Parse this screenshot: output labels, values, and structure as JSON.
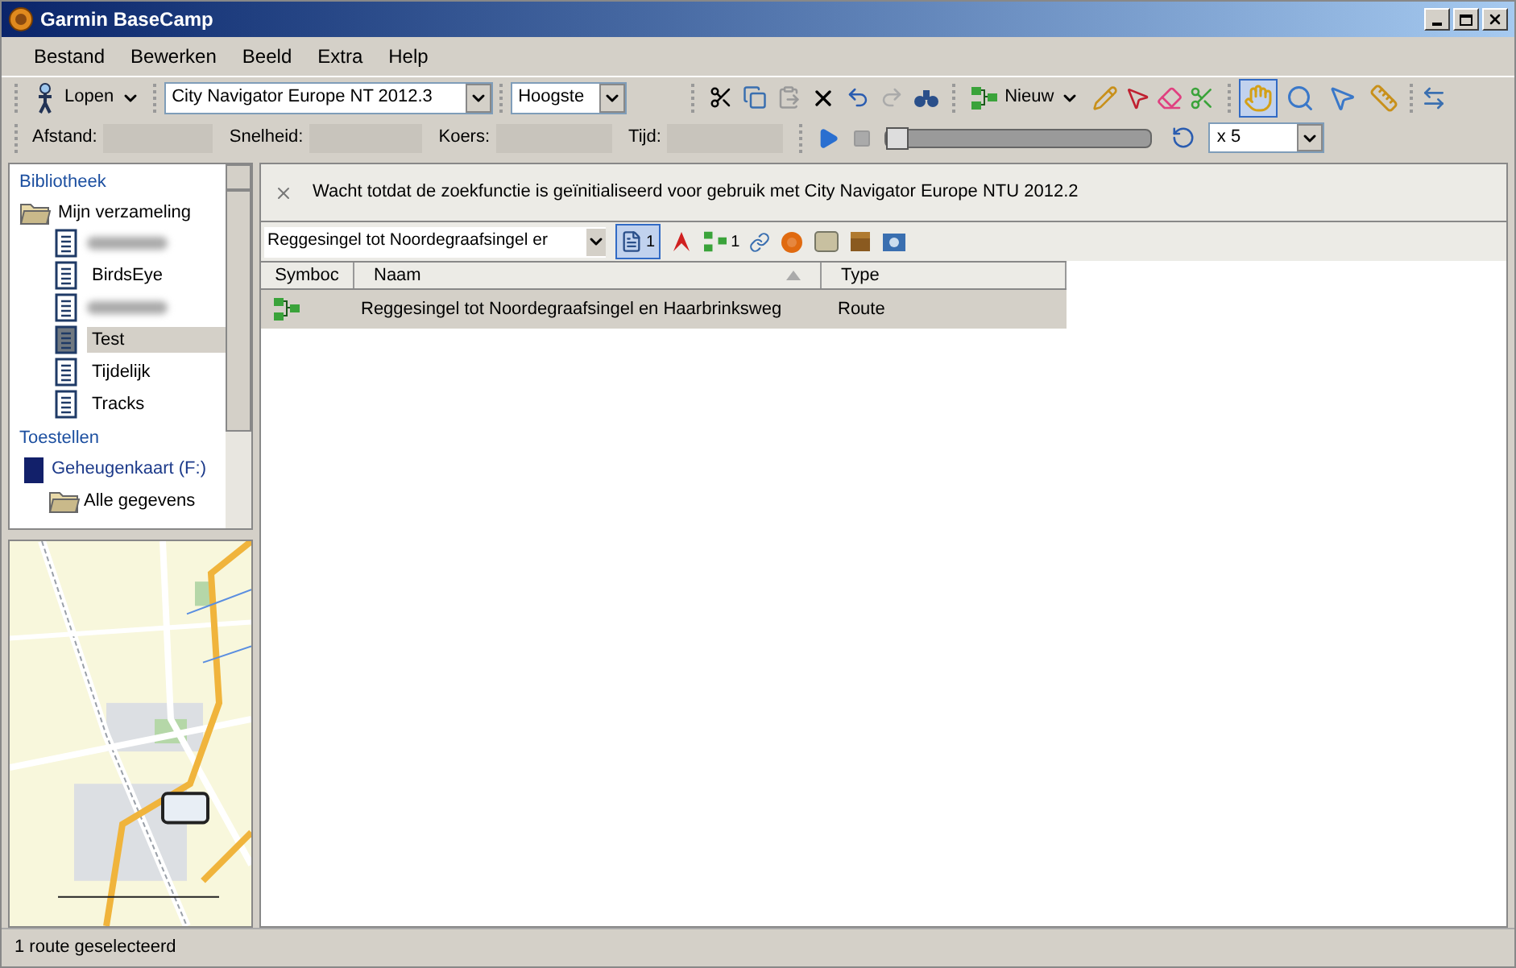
{
  "window": {
    "title": "Garmin BaseCamp"
  },
  "menu": [
    "Bestand",
    "Bewerken",
    "Beeld",
    "Extra",
    "Help"
  ],
  "toolbar": {
    "activity": "Lopen",
    "map_product": "City Navigator Europe NT 2012.3",
    "detail": "Hoogste",
    "new_button": "Nieuw",
    "tools": [
      {
        "kind": "hand",
        "selected": true
      },
      {
        "kind": "zoom",
        "selected": false
      },
      {
        "kind": "pointer",
        "selected": false
      },
      {
        "kind": "ruler",
        "selected": false
      }
    ]
  },
  "measure": {
    "labels": [
      "Afstand:",
      "Snelheid:",
      "Koers:",
      "Tijd:"
    ]
  },
  "playback": {
    "level": 0,
    "speed": "x 5"
  },
  "library": {
    "heading": "Bibliotheek",
    "root": {
      "label": "Mijn verzameling",
      "expanded": true,
      "children": [
        {
          "kind": "redacted",
          "selected": false
        },
        {
          "kind": "list",
          "label": "BirdsEye",
          "selected": false
        },
        {
          "kind": "redacted",
          "selected": false
        },
        {
          "kind": "list",
          "label": "Test",
          "selected": true
        },
        {
          "kind": "list",
          "label": "Tijdelijk",
          "selected": false
        },
        {
          "kind": "list",
          "label": "Tracks",
          "selected": false
        }
      ]
    }
  },
  "devices": {
    "heading": "Toestellen",
    "items": [
      {
        "label": "Geheugenkaart (F:)",
        "children": [
          {
            "label": "Alle gegevens"
          }
        ]
      }
    ]
  },
  "notice": {
    "text": "Wacht totdat de zoekfunctie is geïnitialiseerd voor gebruik met City Navigator Europe NTU 2012.2"
  },
  "filter": {
    "value": "Reggesingel tot Noordegraafsingel er",
    "lists_count": "1",
    "routes_count": "1"
  },
  "table": {
    "columns": [
      "Symboc",
      "Naam",
      "Type"
    ],
    "rows": [
      {
        "name": "Reggesingel tot Noordegraafsingel en Haarbrinksweg",
        "type": "Route",
        "selected": true
      }
    ]
  },
  "status_bar": "1 route geselecteerd"
}
